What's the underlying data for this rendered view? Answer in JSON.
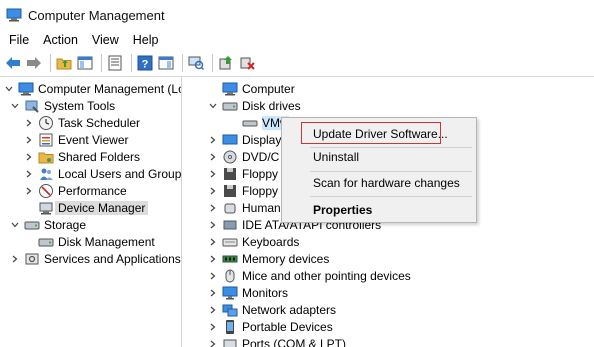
{
  "window": {
    "title": "Computer Management"
  },
  "menu": [
    "File",
    "Action",
    "View",
    "Help"
  ],
  "toolbar": [
    "back-icon",
    "forward-icon",
    "up-folder-icon",
    "show-tree-icon",
    "properties-icon",
    "help-icon",
    "show-hide-icon",
    "scan-hardware-icon",
    "update-driver-icon",
    "uninstall-icon"
  ],
  "left_tree": {
    "root": "Computer Management (Local",
    "system_tools": "System Tools",
    "task_scheduler": "Task Scheduler",
    "event_viewer": "Event Viewer",
    "shared_folders": "Shared Folders",
    "local_users": "Local Users and Groups",
    "performance": "Performance",
    "device_manager": "Device Manager",
    "storage": "Storage",
    "disk_management": "Disk Management",
    "services_apps": "Services and Applications"
  },
  "device_tree": {
    "computer": "Computer",
    "disk_drives": "Disk drives",
    "disk_device": "VMw",
    "disk_device_tail": "VMware Virtual S SCSI Disk Device",
    "display": "Display",
    "dvd": "DVD/C",
    "floppy1": "Floppy",
    "floppy2": "Floppy",
    "human": "Human",
    "ide": "IDE ATA/ATAPI controllers",
    "keyboards": "Keyboards",
    "memory": "Memory devices",
    "mice": "Mice and other pointing devices",
    "monitors": "Monitors",
    "network": "Network adapters",
    "portable": "Portable Devices",
    "ports": "Ports (COM & LPT)"
  },
  "context_menu": {
    "update": "Update Driver Software...",
    "uninstall": "Uninstall",
    "scan": "Scan for hardware changes",
    "properties": "Properties"
  },
  "colors": {
    "highlight_border": "#c9373a",
    "selection": "#dcdcdc"
  }
}
